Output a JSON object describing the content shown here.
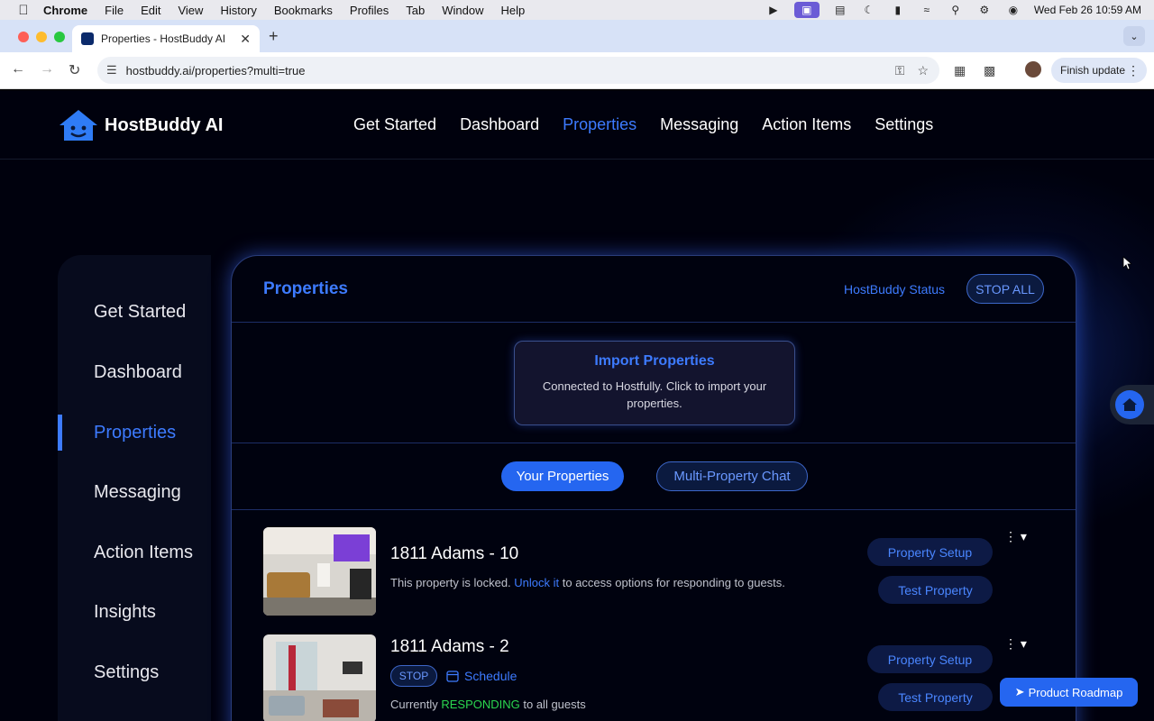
{
  "menubar": {
    "app": "Chrome",
    "items": [
      "File",
      "Edit",
      "View",
      "History",
      "Bookmarks",
      "Profiles",
      "Tab",
      "Window",
      "Help"
    ],
    "datetime": "Wed Feb 26  10:59 AM"
  },
  "browser": {
    "tab_title": "Properties - HostBuddy AI",
    "url": "hostbuddy.ai/properties?multi=true",
    "finish_update": "Finish update"
  },
  "site": {
    "logo_text": "HostBuddy AI",
    "nav": [
      "Get Started",
      "Dashboard",
      "Properties",
      "Messaging",
      "Action Items",
      "Settings"
    ],
    "active_nav": "Properties"
  },
  "sidebar": {
    "items": [
      "Get Started",
      "Dashboard",
      "Properties",
      "Messaging",
      "Action Items",
      "Insights",
      "Settings"
    ],
    "active": "Properties"
  },
  "panel": {
    "title": "Properties",
    "status_label": "HostBuddy Status",
    "stop_all": "STOP ALL",
    "import_title": "Import Properties",
    "import_desc": "Connected to Hostfully. Click to import your properties.",
    "tab_your": "Your Properties",
    "tab_multi": "Multi-Property Chat"
  },
  "properties": [
    {
      "name": "1811 Adams - 10",
      "desc_pre": "This property is locked. ",
      "desc_link": "Unlock it",
      "desc_post": " to access options for responding to guests.",
      "setup": "Property Setup",
      "test": "Test Property"
    },
    {
      "name": "1811 Adams - 2",
      "stop": "STOP",
      "schedule": "Schedule",
      "status_pre": "Currently ",
      "status_word": "RESPONDING",
      "status_post": " to all guests",
      "setup": "Property Setup",
      "test": "Test Property"
    }
  ],
  "roadmap": "Product Roadmap",
  "colors": {
    "accent": "#3d7bff",
    "primary_button": "#2566f0",
    "responding": "#2bd84f",
    "background": "#00010d"
  }
}
